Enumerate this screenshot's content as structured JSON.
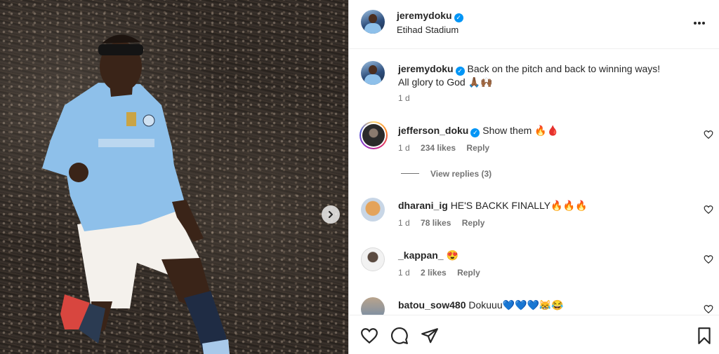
{
  "post": {
    "author": "jeremydoku",
    "location": "Etihad Stadium",
    "caption_line1": "Back on the pitch and back to winning ways!",
    "caption_line2": "All glory to God 🙏🏾🙌🏾",
    "caption_time": "1 d"
  },
  "comments": [
    {
      "user": "jefferson_doku",
      "text": "Show them 🔥🩸",
      "time": "1 d",
      "likes": "234 likes",
      "reply": "Reply",
      "verified": true
    },
    {
      "user": "dharani_ig",
      "text": "HE'S BACKK FINALLY🔥🔥🔥",
      "time": "1 d",
      "likes": "78 likes",
      "reply": "Reply"
    },
    {
      "user": "_kappan_",
      "text": "😍",
      "time": "1 d",
      "likes": "2 likes",
      "reply": "Reply"
    },
    {
      "user": "batou_sow480",
      "text": "Dokuuu💙💙💙😹😂"
    }
  ],
  "view_replies": "View replies (3)",
  "icons": {
    "more": "more-options-icon",
    "next": "chevron-right-icon",
    "like": "heart-icon",
    "comment": "comment-icon",
    "share": "send-icon",
    "save": "bookmark-icon",
    "verified": "verified-badge-icon"
  },
  "colors": {
    "verified": "#0095f6",
    "muted": "#737373",
    "text": "#262626",
    "kit_blue": "#8ec0ea"
  }
}
